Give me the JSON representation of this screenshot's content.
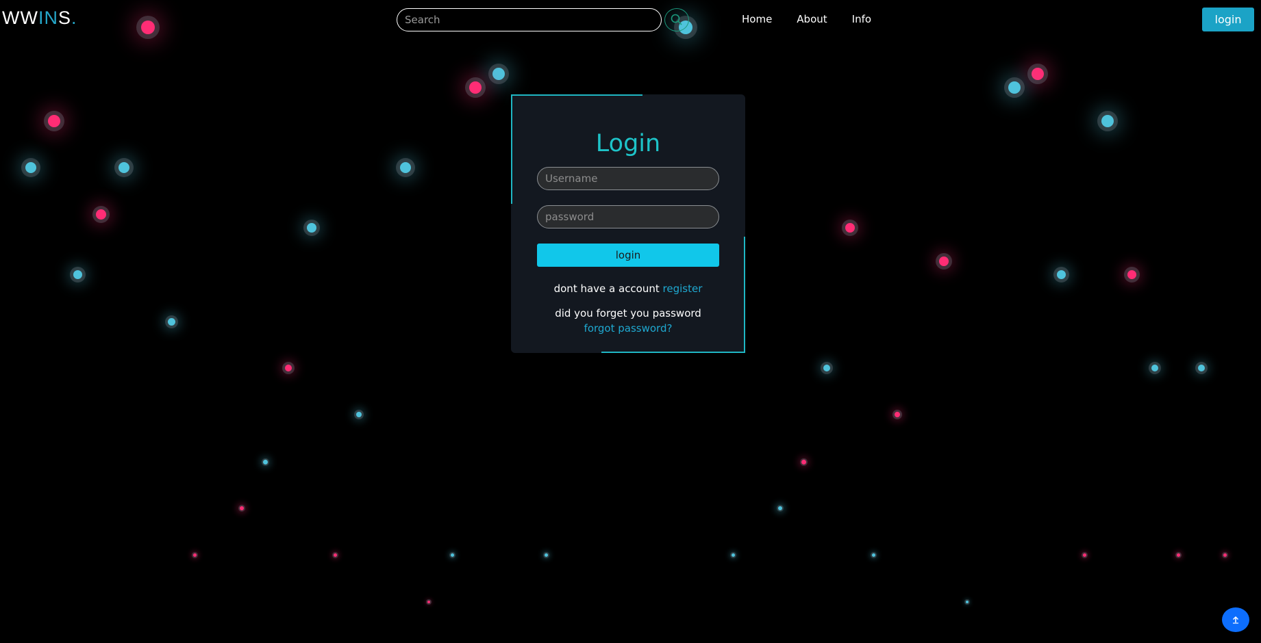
{
  "header": {
    "brand": {
      "part1": "WW",
      "part2": "IN",
      "part3": "S",
      "dot": "."
    },
    "search": {
      "placeholder": "Search",
      "value": "",
      "icon": "search-icon"
    },
    "nav": [
      {
        "label": "Home"
      },
      {
        "label": "About"
      },
      {
        "label": "Info"
      }
    ],
    "login_button": "login"
  },
  "login_card": {
    "title": "Login",
    "username_placeholder": "Username",
    "password_placeholder": "password",
    "login_button": "login",
    "register_prompt": "dont have a account ",
    "register_link": "register",
    "forgot_prompt": "did you forget you password ",
    "forgot_link": "forgot password?"
  },
  "scroll_top": {
    "icon": "arrow-up-icon"
  },
  "colors": {
    "background": "#000000",
    "accent_cyan": "#1fb7c4",
    "particle_blue": "#4fc3dc",
    "particle_pink": "#ff2d75",
    "button_blue": "#0d6efd"
  }
}
